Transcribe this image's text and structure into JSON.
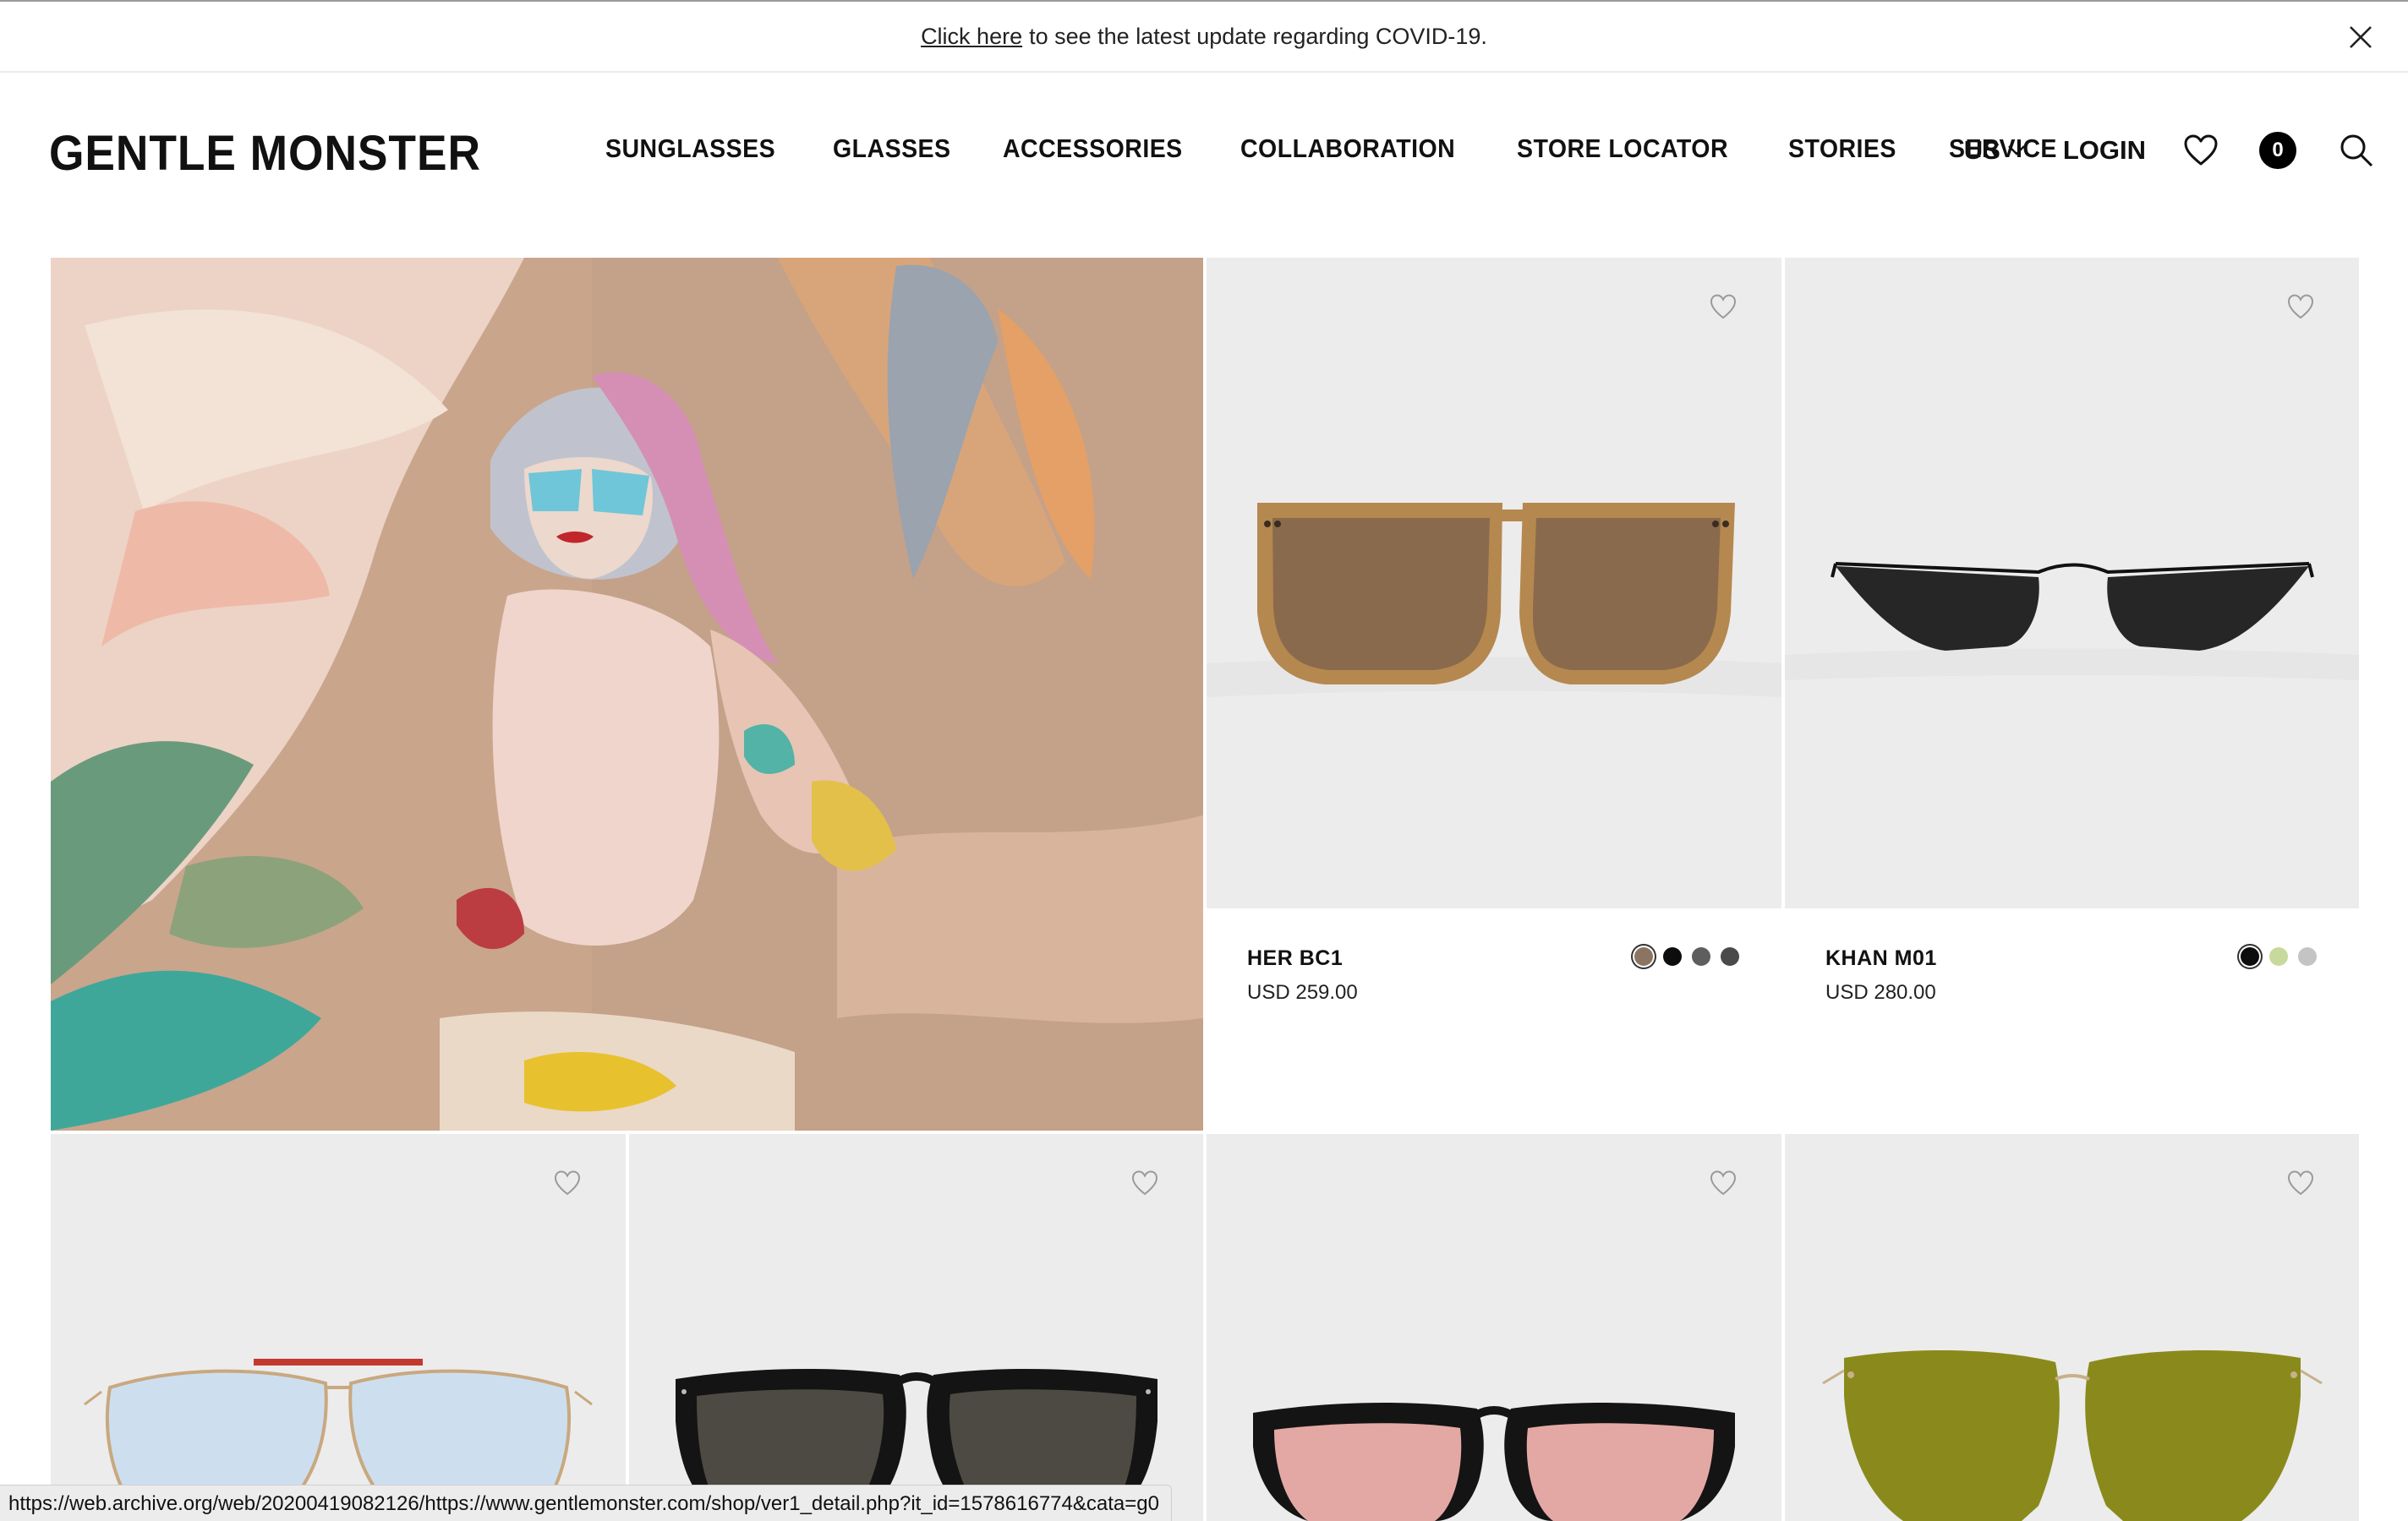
{
  "announcement": {
    "link_text": "Click here",
    "text": "to see the latest update regarding COVID-19."
  },
  "header": {
    "logo": "GENTLE MONSTER",
    "nav": [
      "SUNGLASSES",
      "GLASSES",
      "ACCESSORIES",
      "COLLABORATION",
      "STORE LOCATOR",
      "STORIES",
      "SERVICE"
    ],
    "region": "US",
    "login": "LOGIN",
    "cart_count": "0"
  },
  "products": [
    {
      "name": "HER BC1",
      "price": "USD 259.00",
      "swatches": [
        "#8c7463",
        "#0d0d0d",
        "#5e5e5e",
        "#4a4a4a"
      ],
      "selected_swatch": 0
    },
    {
      "name": "KHAN M01",
      "price": "USD 280.00",
      "swatches": [
        "#0d0d0d",
        "#c7d99c",
        "#c4c4c4"
      ],
      "selected_swatch": 0
    }
  ],
  "icons": {
    "close": "close-icon",
    "region_chevron": "chevron-down-icon",
    "wishlist": "heart-icon",
    "search": "search-icon",
    "product_wish": "heart-outline-icon"
  },
  "status_bar": {
    "url": "https://web.archive.org/web/20200419082126/https://www.gentlemonster.com/shop/ver1_detail.php?it_id=1578616774&cata=g0"
  }
}
